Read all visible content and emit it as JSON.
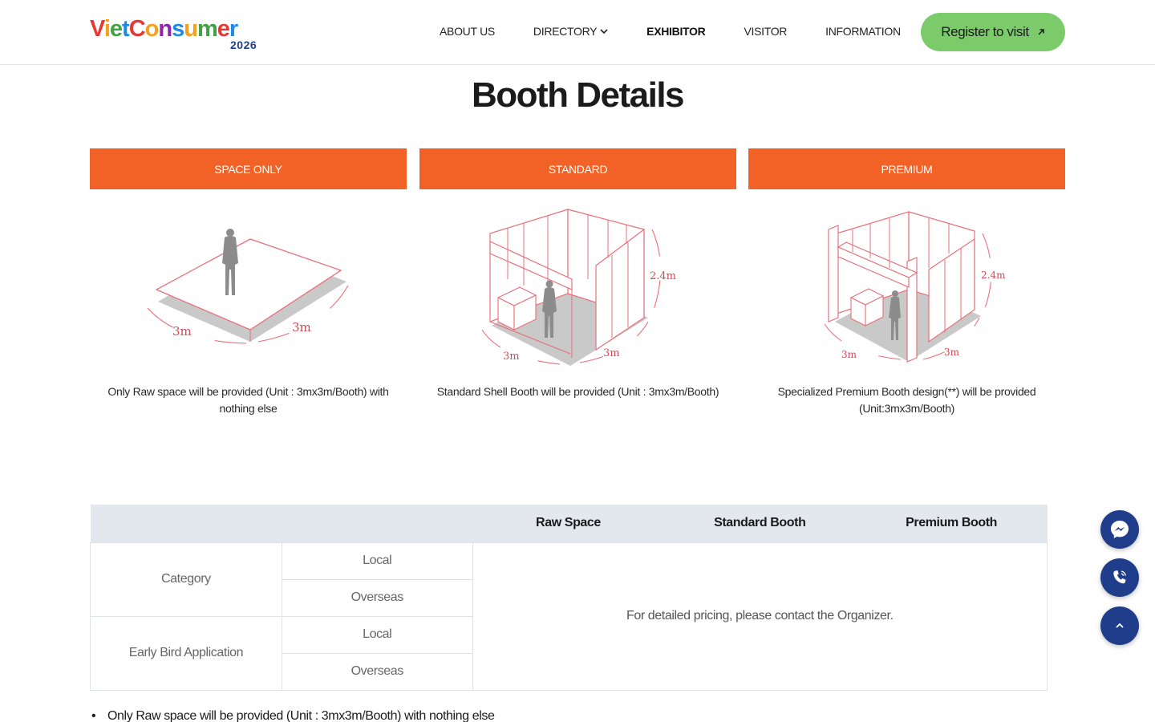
{
  "header": {
    "logo": {
      "word_letters": [
        {
          "ch": "V",
          "color": "#e53935"
        },
        {
          "ch": "i",
          "color": "#f4a020"
        },
        {
          "ch": "e",
          "color": "#43a047"
        },
        {
          "ch": "t",
          "color": "#1e88e5"
        },
        {
          "ch": "C",
          "color": "#e53935"
        },
        {
          "ch": "o",
          "color": "#f4a020"
        },
        {
          "ch": "n",
          "color": "#8e24aa"
        },
        {
          "ch": "s",
          "color": "#1e88e5"
        },
        {
          "ch": "u",
          "color": "#f4a020"
        },
        {
          "ch": "m",
          "color": "#43a047"
        },
        {
          "ch": "e",
          "color": "#e53935"
        },
        {
          "ch": "r",
          "color": "#1e88e5"
        }
      ],
      "year": "2026"
    },
    "nav": [
      {
        "label": "ABOUT US",
        "active": false,
        "dropdown": false
      },
      {
        "label": "DIRECTORY",
        "active": false,
        "dropdown": true
      },
      {
        "label": "EXHIBITOR",
        "active": true,
        "dropdown": false
      },
      {
        "label": "VISITOR",
        "active": false,
        "dropdown": false
      },
      {
        "label": "INFORMATION",
        "active": false,
        "dropdown": false
      }
    ],
    "register_label": "Register to visit"
  },
  "main": {
    "title": "Booth Details",
    "booths": [
      {
        "tab": "SPACE ONLY",
        "description": "Only Raw space will be provided (Unit : 3mx3m/Booth) with nothing else",
        "dims": [
          "3m",
          "3m"
        ]
      },
      {
        "tab": "STANDARD",
        "description": "Standard Shell Booth will be provided (Unit : 3mx3m/Booth)",
        "dims": [
          "3m",
          "3m",
          "2.4m"
        ]
      },
      {
        "tab": "PREMIUM",
        "description": "Specialized Premium Booth design(**) will be provided (Unit:3mx3m/Booth)",
        "dims": [
          "3m",
          "3m",
          "2.4m"
        ]
      }
    ],
    "table": {
      "headers": [
        "",
        "",
        "Raw Space",
        "Standard Booth",
        "Premium Booth"
      ],
      "rows": [
        {
          "group": "Category",
          "sub": [
            "Local",
            "Overseas"
          ]
        },
        {
          "group": "Early Bird Application",
          "sub": [
            "Local",
            "Overseas"
          ]
        }
      ],
      "note": "For detailed pricing, please contact the Organizer."
    },
    "bullets": [
      "Only Raw space will be provided (Unit : 3mx3m/Booth) with nothing else"
    ]
  },
  "floating": {
    "buttons": [
      {
        "icon": "messenger-icon"
      },
      {
        "icon": "phone-icon"
      },
      {
        "icon": "chevron-up-icon"
      }
    ]
  },
  "colors": {
    "accent_orange": "#f26226",
    "register_green": "#7ccb6b",
    "navy": "#1f3d8a",
    "table_header": "#e3e7ee",
    "line_red": "#e8707a"
  }
}
